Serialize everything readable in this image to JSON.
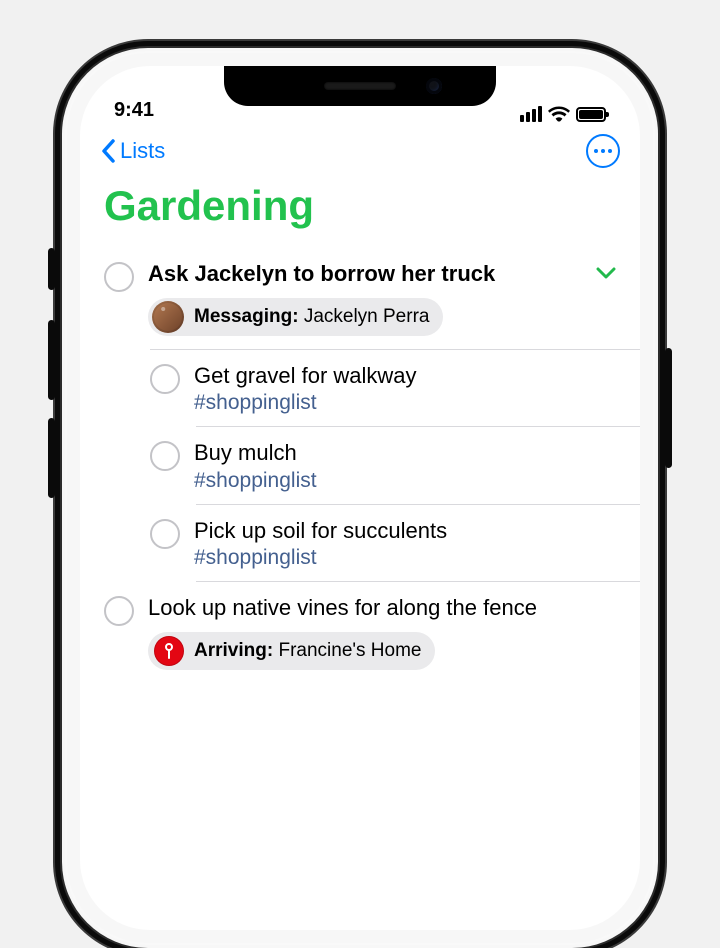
{
  "status": {
    "time": "9:41"
  },
  "nav": {
    "back_label": "Lists"
  },
  "page": {
    "title": "Gardening",
    "title_color": "#22c24e"
  },
  "reminders": [
    {
      "title": "Ask Jackelyn to borrow her truck",
      "bold": true,
      "expanded": true,
      "pill": {
        "type": "messaging",
        "label": "Messaging:",
        "value": "Jackelyn Perra"
      },
      "subtasks": [
        {
          "title": "Get gravel for walkway",
          "tag": "#shoppinglist"
        },
        {
          "title": "Buy mulch",
          "tag": "#shoppinglist"
        },
        {
          "title": "Pick up soil for succulents",
          "tag": "#shoppinglist"
        }
      ]
    },
    {
      "title": "Look up native vines for along the fence",
      "pill": {
        "type": "location",
        "label": "Arriving:",
        "value": "Francine's Home"
      }
    }
  ]
}
